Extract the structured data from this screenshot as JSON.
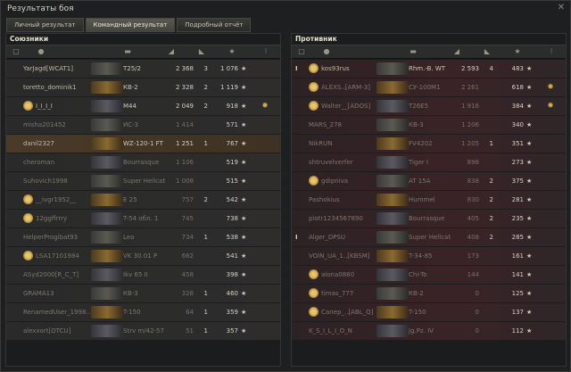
{
  "window": {
    "title": "Результаты боя",
    "close_icon": "close-icon"
  },
  "tabs": [
    {
      "label": "Личный результат",
      "active": false
    },
    {
      "label": "Командный результат",
      "active": true
    },
    {
      "label": "Подробный отчёт",
      "active": false
    }
  ],
  "allies": {
    "title": "Союзники",
    "header_icons": [
      "squad-icon",
      "player-icon",
      "tank-icon",
      "damage-icon",
      "kills-icon",
      "xp-icon",
      "medal-icon"
    ],
    "rows": [
      {
        "player": "YarJagd[WCAT1]",
        "tank": "T25/2",
        "damage": "2 368",
        "kills": "3",
        "xp": "1 076",
        "alive": true,
        "highlight": "top",
        "badge": "",
        "medal": false
      },
      {
        "player": "toretto_dominik1",
        "tank": "КВ-2",
        "damage": "2 328",
        "kills": "2",
        "xp": "1 119",
        "alive": true,
        "highlight": "",
        "badge": "",
        "medal": false
      },
      {
        "player": "I_I_I_I",
        "tank": "M44",
        "damage": "2 049",
        "kills": "2",
        "xp": "918",
        "alive": true,
        "highlight": "",
        "badge": "emblem-icon",
        "medal": true
      },
      {
        "player": "misha201452",
        "tank": "ИС-3",
        "damage": "1 414",
        "kills": "",
        "xp": "571",
        "alive": false,
        "highlight": "",
        "badge": "",
        "medal": false
      },
      {
        "player": "danil2327",
        "tank": "WZ-120-1 FT",
        "damage": "1 251",
        "kills": "1",
        "xp": "767",
        "alive": true,
        "highlight": "me",
        "badge": "",
        "medal": false
      },
      {
        "player": "cheroman",
        "tank": "Bourrasque",
        "damage": "1 106",
        "kills": "",
        "xp": "519",
        "alive": false,
        "highlight": "",
        "badge": "",
        "medal": false
      },
      {
        "player": "Suhovich1998",
        "tank": "Super Hellcat",
        "damage": "1 008",
        "kills": "",
        "xp": "515",
        "alive": false,
        "highlight": "",
        "badge": "",
        "medal": false
      },
      {
        "player": "__ivgr1952__",
        "tank": "E 25",
        "damage": "757",
        "kills": "2",
        "xp": "542",
        "alive": false,
        "highlight": "",
        "badge": "star-rank-icon",
        "medal": false
      },
      {
        "player": "12ggffrrry",
        "tank": "T-54 обл. 1",
        "damage": "745",
        "kills": "",
        "xp": "738",
        "alive": false,
        "highlight": "",
        "badge": "star-rank-icon",
        "medal": false
      },
      {
        "player": "HelperProgibat93",
        "tank": "Leo",
        "damage": "734",
        "kills": "1",
        "xp": "538",
        "alive": false,
        "highlight": "",
        "badge": "",
        "medal": false
      },
      {
        "player": "LSA17101984",
        "tank": "VK 30.01 P",
        "damage": "662",
        "kills": "",
        "xp": "541",
        "alive": false,
        "highlight": "",
        "badge": "star-rank-icon",
        "medal": false
      },
      {
        "player": "ASyd2000[R_C_T]",
        "tank": "Ikv 65 II",
        "damage": "458",
        "kills": "",
        "xp": "398",
        "alive": false,
        "highlight": "",
        "badge": "",
        "medal": false
      },
      {
        "player": "GRAMA13",
        "tank": "КВ-3",
        "damage": "328",
        "kills": "1",
        "xp": "460",
        "alive": false,
        "highlight": "",
        "badge": "",
        "medal": false
      },
      {
        "player": "RenamedUser_1998...",
        "tank": "T-150",
        "damage": "64",
        "kills": "1",
        "xp": "359",
        "alive": false,
        "highlight": "",
        "badge": "",
        "medal": false
      },
      {
        "player": "alexxort[OTCU]",
        "tank": "Strv m/42-57",
        "damage": "51",
        "kills": "1",
        "xp": "357",
        "alive": false,
        "highlight": "",
        "badge": "",
        "medal": false
      }
    ]
  },
  "enemies": {
    "title": "Противник",
    "header_icons": [
      "squad-icon",
      "player-icon",
      "tank-icon",
      "damage-icon",
      "kills-icon",
      "xp-icon",
      "medal-icon"
    ],
    "rows": [
      {
        "player": "kos93rus",
        "tank": "Rhm.-B. WT",
        "damage": "2 593",
        "kills": "4",
        "xp": "483",
        "alive": true,
        "squad": "I",
        "badge": "lion-icon",
        "medal": false
      },
      {
        "player": "ALEXS..[ARM-3]",
        "tank": "СУ-100М1",
        "damage": "2 261",
        "kills": "",
        "xp": "618",
        "alive": false,
        "squad": "",
        "badge": "star-rank-icon",
        "medal": true
      },
      {
        "player": "Walter__[ADOS]",
        "tank": "T26E5",
        "damage": "1 916",
        "kills": "",
        "xp": "384",
        "alive": false,
        "squad": "",
        "badge": "star-rank-icon",
        "medal": true
      },
      {
        "player": "MARS_278",
        "tank": "КВ-3",
        "damage": "1 206",
        "kills": "",
        "xp": "340",
        "alive": false,
        "squad": "",
        "badge": "",
        "medal": false
      },
      {
        "player": "NikRUN",
        "tank": "FV4202",
        "damage": "1 205",
        "kills": "1",
        "xp": "351",
        "alive": false,
        "squad": "",
        "badge": "",
        "medal": false
      },
      {
        "player": "shtruvelverfer",
        "tank": "Tiger I",
        "damage": "898",
        "kills": "",
        "xp": "273",
        "alive": false,
        "squad": "",
        "badge": "",
        "medal": false
      },
      {
        "player": "gdipniva",
        "tank": "AT 15A",
        "damage": "838",
        "kills": "2",
        "xp": "375",
        "alive": false,
        "squad": "",
        "badge": "gear-badge-icon",
        "medal": false
      },
      {
        "player": "Pashokius",
        "tank": "Hummel",
        "damage": "830",
        "kills": "2",
        "xp": "281",
        "alive": false,
        "squad": "",
        "badge": "",
        "medal": false
      },
      {
        "player": "piotr1234567890",
        "tank": "Bourrasque",
        "damage": "405",
        "kills": "2",
        "xp": "235",
        "alive": false,
        "squad": "",
        "badge": "",
        "medal": false
      },
      {
        "player": "Alger_DPSU",
        "tank": "Super Hellcat",
        "damage": "408",
        "kills": "2",
        "xp": "285",
        "alive": false,
        "squad": "I",
        "badge": "",
        "medal": false
      },
      {
        "player": "VOIN_UA_1..[KBSM]",
        "tank": "T-34-85",
        "damage": "173",
        "kills": "",
        "xp": "161",
        "alive": false,
        "squad": "",
        "badge": "",
        "medal": false
      },
      {
        "player": "alona0880",
        "tank": "Chi-To",
        "damage": "144",
        "kills": "",
        "xp": "141",
        "alive": false,
        "squad": "",
        "badge": "diamond-icon",
        "medal": false
      },
      {
        "player": "timas_777",
        "tank": "КВ-2",
        "damage": "0",
        "kills": "",
        "xp": "125",
        "alive": false,
        "squad": "",
        "badge": "star-rank-icon",
        "medal": false
      },
      {
        "player": "Сапер_..[ABL_Q]",
        "tank": "T-150",
        "damage": "0",
        "kills": "",
        "xp": "137",
        "alive": false,
        "squad": "",
        "badge": "star-rank-icon",
        "medal": false
      },
      {
        "player": "K_S_I_L_I_O_N",
        "tank": "Jg.Pz. IV",
        "damage": "0",
        "kills": "",
        "xp": "112",
        "alive": false,
        "squad": "",
        "badge": "",
        "medal": false
      }
    ]
  },
  "colors": {
    "gold": "#d0a84a",
    "bg": "#1e1f21",
    "enemy_tint": "#3a2326",
    "me_tint": "#4a3a28"
  }
}
